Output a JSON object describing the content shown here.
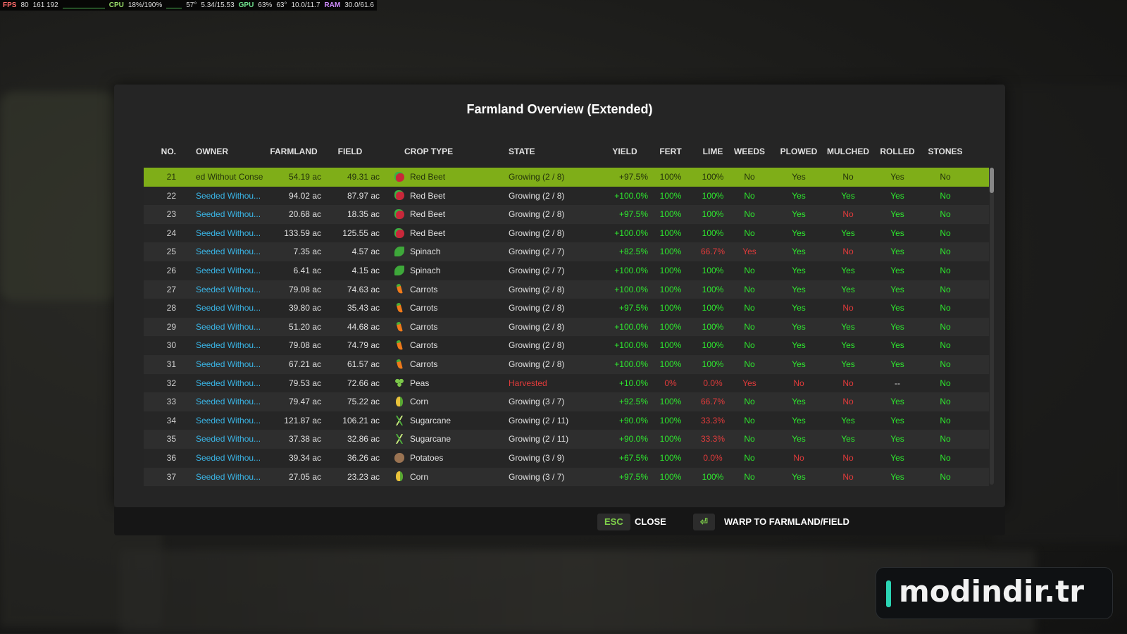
{
  "osd": {
    "fps": "FPS",
    "fps_val": "80",
    "frame_val": "161 192",
    "cpu": "CPU",
    "cpu_val": "18%/190%",
    "cpu_temp": "57°",
    "cpu_clock": "5.34/15.53",
    "gpu": "GPU",
    "gpu_val": "63%",
    "gpu_temp": "63°",
    "vram": "10.0/11.7",
    "ram": "RAM",
    "ram_val": "30.0/61.6"
  },
  "dialog": {
    "title": "Farmland Overview (Extended)"
  },
  "columns": {
    "no": "NO.",
    "owner": "OWNER",
    "farmland": "FARMLAND",
    "field": "FIELD",
    "crop": "CROP TYPE",
    "state": "STATE",
    "yield": "YIELD",
    "fert": "FERT",
    "lime": "LIME",
    "weeds": "WEEDS",
    "plowed": "PLOWED",
    "mulched": "MULCHED",
    "rolled": "ROLLED",
    "stones": "STONES"
  },
  "rows": [
    {
      "no": "21",
      "owner": "ed Without Conse",
      "farmland": "54.19 ac",
      "field": "49.31 ac",
      "icon": "beet",
      "crop": "Red Beet",
      "state": "Growing (2 / 8)",
      "yield": "+97.5%",
      "fert": "100%",
      "lime": "100%",
      "weeds": "No",
      "plowed": "Yes",
      "mulched": "No",
      "rolled": "Yes",
      "stones": "No"
    },
    {
      "no": "22",
      "owner": "Seeded Withou...",
      "farmland": "94.02 ac",
      "field": "87.97 ac",
      "icon": "beet",
      "crop": "Red Beet",
      "state": "Growing (2 / 8)",
      "yield": "+100.0%",
      "fert": "100%",
      "lime": "100%",
      "weeds": "No",
      "plowed": "Yes",
      "mulched": "Yes",
      "rolled": "Yes",
      "stones": "No"
    },
    {
      "no": "23",
      "owner": "Seeded Withou...",
      "farmland": "20.68 ac",
      "field": "18.35 ac",
      "icon": "beet",
      "crop": "Red Beet",
      "state": "Growing (2 / 8)",
      "yield": "+97.5%",
      "fert": "100%",
      "lime": "100%",
      "weeds": "No",
      "plowed": "Yes",
      "mulched": "No",
      "rolled": "Yes",
      "stones": "No"
    },
    {
      "no": "24",
      "owner": "Seeded Withou...",
      "farmland": "133.59 ac",
      "field": "125.55 ac",
      "icon": "beet",
      "crop": "Red Beet",
      "state": "Growing (2 / 8)",
      "yield": "+100.0%",
      "fert": "100%",
      "lime": "100%",
      "weeds": "No",
      "plowed": "Yes",
      "mulched": "Yes",
      "rolled": "Yes",
      "stones": "No"
    },
    {
      "no": "25",
      "owner": "Seeded Withou...",
      "farmland": "7.35 ac",
      "field": "4.57 ac",
      "icon": "spinach",
      "crop": "Spinach",
      "state": "Growing (2 / 7)",
      "yield": "+82.5%",
      "fert": "100%",
      "lime": "66.7%",
      "weeds": "Yes",
      "plowed": "Yes",
      "mulched": "No",
      "rolled": "Yes",
      "stones": "No"
    },
    {
      "no": "26",
      "owner": "Seeded Withou...",
      "farmland": "6.41 ac",
      "field": "4.15 ac",
      "icon": "spinach",
      "crop": "Spinach",
      "state": "Growing (2 / 7)",
      "yield": "+100.0%",
      "fert": "100%",
      "lime": "100%",
      "weeds": "No",
      "plowed": "Yes",
      "mulched": "Yes",
      "rolled": "Yes",
      "stones": "No"
    },
    {
      "no": "27",
      "owner": "Seeded Withou...",
      "farmland": "79.08 ac",
      "field": "74.63 ac",
      "icon": "carrot",
      "crop": "Carrots",
      "state": "Growing (2 / 8)",
      "yield": "+100.0%",
      "fert": "100%",
      "lime": "100%",
      "weeds": "No",
      "plowed": "Yes",
      "mulched": "Yes",
      "rolled": "Yes",
      "stones": "No"
    },
    {
      "no": "28",
      "owner": "Seeded Withou...",
      "farmland": "39.80 ac",
      "field": "35.43 ac",
      "icon": "carrot",
      "crop": "Carrots",
      "state": "Growing (2 / 8)",
      "yield": "+97.5%",
      "fert": "100%",
      "lime": "100%",
      "weeds": "No",
      "plowed": "Yes",
      "mulched": "No",
      "rolled": "Yes",
      "stones": "No"
    },
    {
      "no": "29",
      "owner": "Seeded Withou...",
      "farmland": "51.20 ac",
      "field": "44.68 ac",
      "icon": "carrot",
      "crop": "Carrots",
      "state": "Growing (2 / 8)",
      "yield": "+100.0%",
      "fert": "100%",
      "lime": "100%",
      "weeds": "No",
      "plowed": "Yes",
      "mulched": "Yes",
      "rolled": "Yes",
      "stones": "No"
    },
    {
      "no": "30",
      "owner": "Seeded Withou...",
      "farmland": "79.08 ac",
      "field": "74.79 ac",
      "icon": "carrot",
      "crop": "Carrots",
      "state": "Growing (2 / 8)",
      "yield": "+100.0%",
      "fert": "100%",
      "lime": "100%",
      "weeds": "No",
      "plowed": "Yes",
      "mulched": "Yes",
      "rolled": "Yes",
      "stones": "No"
    },
    {
      "no": "31",
      "owner": "Seeded Withou...",
      "farmland": "67.21 ac",
      "field": "61.57 ac",
      "icon": "carrot",
      "crop": "Carrots",
      "state": "Growing (2 / 8)",
      "yield": "+100.0%",
      "fert": "100%",
      "lime": "100%",
      "weeds": "No",
      "plowed": "Yes",
      "mulched": "Yes",
      "rolled": "Yes",
      "stones": "No"
    },
    {
      "no": "32",
      "owner": "Seeded Withou...",
      "farmland": "79.53 ac",
      "field": "72.66 ac",
      "icon": "peas",
      "crop": "Peas",
      "state": "Harvested",
      "yield": "+10.0%",
      "fert": "0%",
      "lime": "0.0%",
      "weeds": "Yes",
      "plowed": "No",
      "mulched": "No",
      "rolled": "--",
      "stones": "No"
    },
    {
      "no": "33",
      "owner": "Seeded Withou...",
      "farmland": "79.47 ac",
      "field": "75.22 ac",
      "icon": "corn",
      "crop": "Corn",
      "state": "Growing (3 / 7)",
      "yield": "+92.5%",
      "fert": "100%",
      "lime": "66.7%",
      "weeds": "No",
      "plowed": "Yes",
      "mulched": "No",
      "rolled": "Yes",
      "stones": "No"
    },
    {
      "no": "34",
      "owner": "Seeded Withou...",
      "farmland": "121.87 ac",
      "field": "106.21 ac",
      "icon": "cane",
      "crop": "Sugarcane",
      "state": "Growing (2 / 11)",
      "yield": "+90.0%",
      "fert": "100%",
      "lime": "33.3%",
      "weeds": "No",
      "plowed": "Yes",
      "mulched": "Yes",
      "rolled": "Yes",
      "stones": "No"
    },
    {
      "no": "35",
      "owner": "Seeded Withou...",
      "farmland": "37.38 ac",
      "field": "32.86 ac",
      "icon": "cane",
      "crop": "Sugarcane",
      "state": "Growing (2 / 11)",
      "yield": "+90.0%",
      "fert": "100%",
      "lime": "33.3%",
      "weeds": "No",
      "plowed": "Yes",
      "mulched": "Yes",
      "rolled": "Yes",
      "stones": "No"
    },
    {
      "no": "36",
      "owner": "Seeded Withou...",
      "farmland": "39.34 ac",
      "field": "36.26 ac",
      "icon": "potato",
      "crop": "Potatoes",
      "state": "Growing (3 / 9)",
      "yield": "+67.5%",
      "fert": "100%",
      "lime": "0.0%",
      "weeds": "No",
      "plowed": "No",
      "mulched": "No",
      "rolled": "Yes",
      "stones": "No"
    },
    {
      "no": "37",
      "owner": "Seeded Withou...",
      "farmland": "27.05 ac",
      "field": "23.23 ac",
      "icon": "corn",
      "crop": "Corn",
      "state": "Growing (3 / 7)",
      "yield": "+97.5%",
      "fert": "100%",
      "lime": "100%",
      "weeds": "No",
      "plowed": "Yes",
      "mulched": "No",
      "rolled": "Yes",
      "stones": "No"
    }
  ],
  "footer": {
    "esc_key": "ESC",
    "close_label": "CLOSE",
    "warp_key": "⏎",
    "warp_label": "WARP TO FARMLAND/FIELD"
  },
  "watermark": {
    "text": "modindir.tr"
  },
  "colors": {
    "selected_row": "#7fae18",
    "positive": "#2ee62e",
    "negative": "#e23b3b",
    "owner_link": "#3ab5e6"
  }
}
